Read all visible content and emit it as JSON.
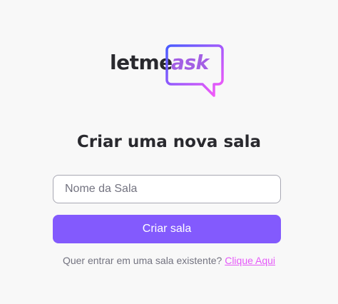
{
  "logo": {
    "word_main": "letme",
    "word_accent": "ask"
  },
  "page": {
    "title": "Criar uma nova sala"
  },
  "form": {
    "room_name_placeholder": "Nome da Sala",
    "room_name_value": "",
    "submit_label": "Criar sala"
  },
  "footer": {
    "prompt": "Quer entrar em uma sala existente?",
    "link_label": "Clique Aqui"
  },
  "colors": {
    "accent": "#835afd",
    "link": "#e559f9",
    "text": "#29292e",
    "muted": "#737380",
    "background": "#f8f8f8"
  }
}
